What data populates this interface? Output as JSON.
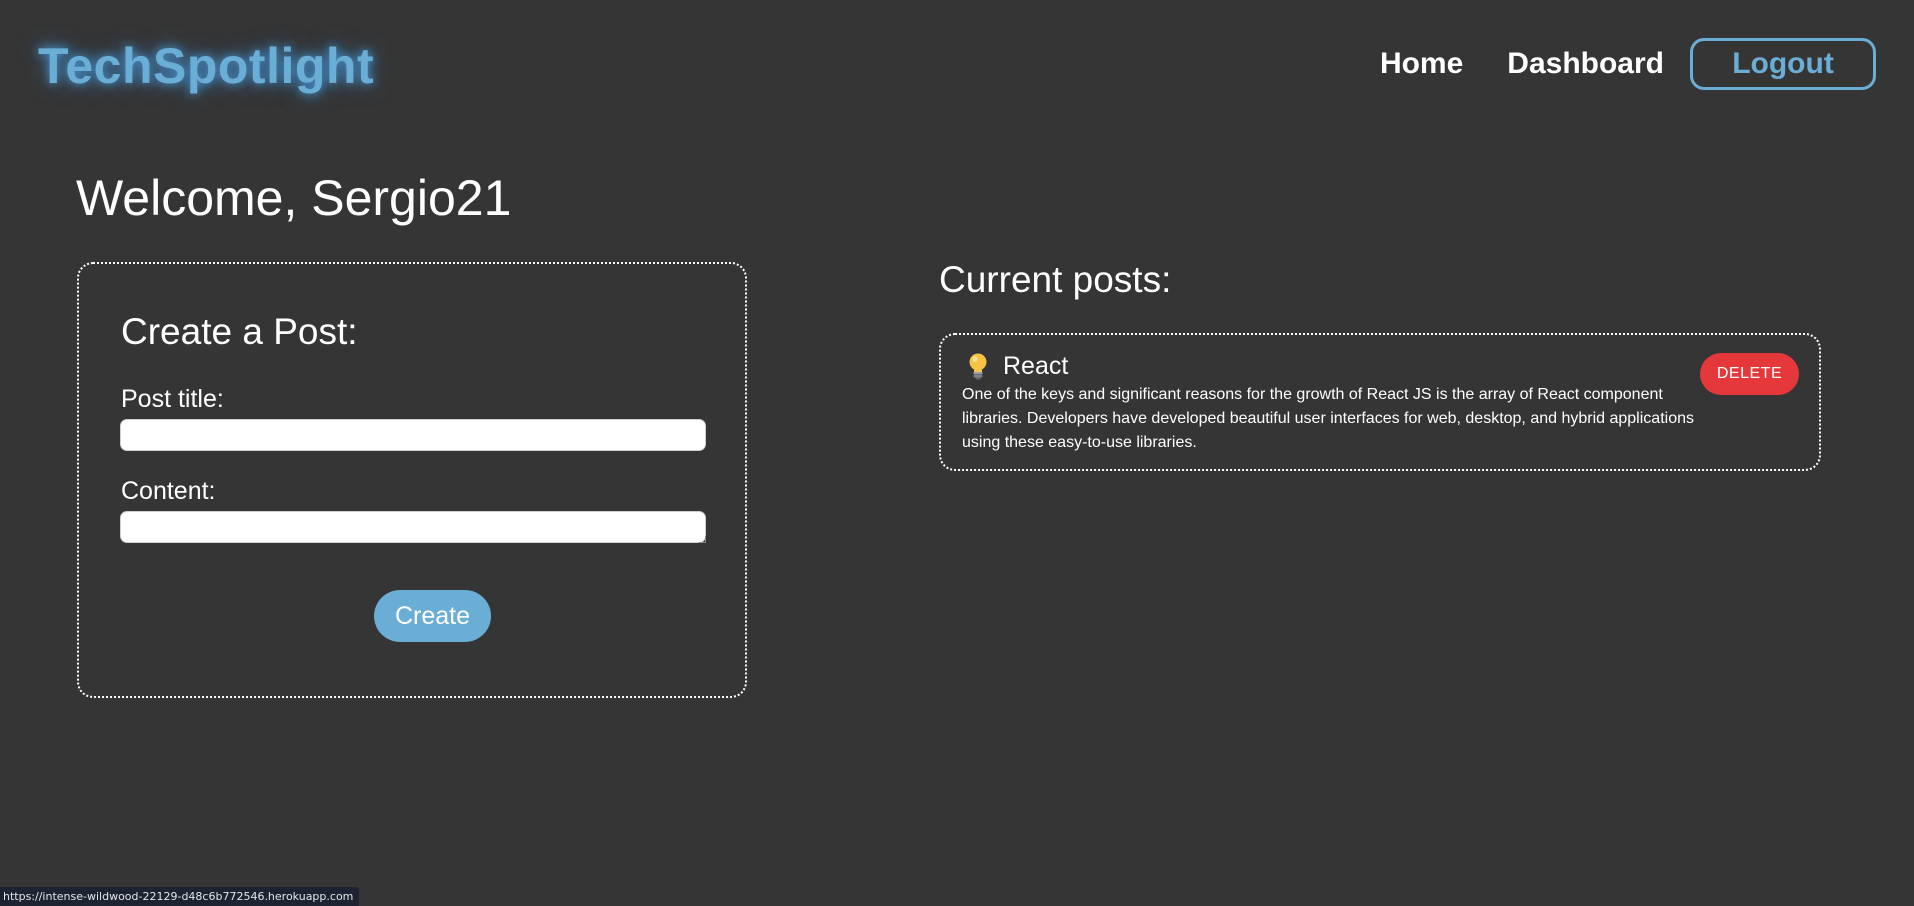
{
  "header": {
    "brand": "TechSpotlight",
    "nav": {
      "home": "Home",
      "dashboard": "Dashboard",
      "logout": "Logout"
    }
  },
  "welcome": "Welcome, Sergio21",
  "create_post": {
    "title": "Create a Post:",
    "post_title_label": "Post title:",
    "post_title_value": "",
    "content_label": "Content:",
    "content_value": "",
    "create_button": "Create"
  },
  "posts": {
    "heading": "Current posts:",
    "items": [
      {
        "icon": "lightbulb-icon",
        "title": "React",
        "body": "One of the keys and significant reasons for the growth of React JS is the array of React component libraries. Developers have developed beautiful user interfaces for web, desktop, and hybrid applications using these easy-to-use libraries.",
        "delete_button": "DELETE"
      }
    ]
  },
  "status_bar": {
    "url": "https://intense-wildwood-22129-d48c6b772546.herokuapp.com"
  },
  "colors": {
    "background": "#353535",
    "accent": "#6aaed6",
    "danger": "#e5383b"
  }
}
